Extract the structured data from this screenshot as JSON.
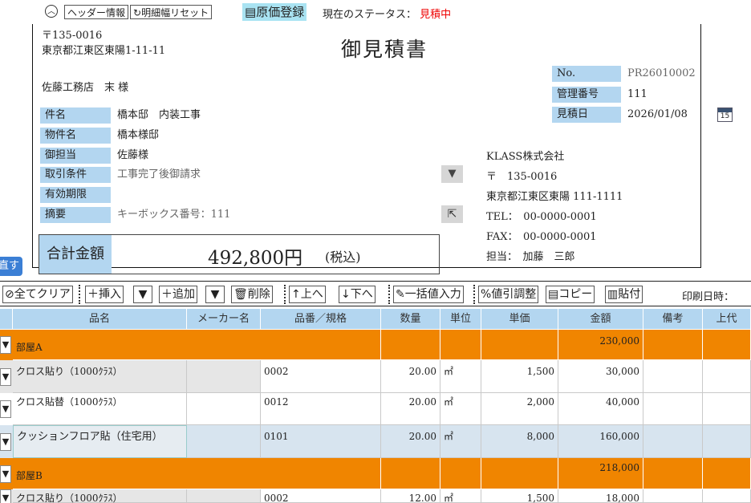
{
  "toolbar": {
    "header_info": "ヘッダー情報",
    "reset_width": "明細幅リセット",
    "cost_register": "原価登録",
    "status_label": "現在のステータス：",
    "status_value": "見積中"
  },
  "header": {
    "postal": "〒135-0016",
    "address": "東京都江東区東陽1-11-11",
    "title": "御見積書",
    "customer": "佐藤工務店　末 様",
    "fields": {
      "subject_label": "件名",
      "subject": "橋本邸　内装工事",
      "property_label": "物件名",
      "property": "橋本様邸",
      "contact_label": "御担当",
      "contact": "佐藤様",
      "terms_label": "取引条件",
      "terms": "工事完了後御請求",
      "validity_label": "有効期限",
      "validity": "",
      "note_label": "摘要",
      "note": "キーボックス番号：111"
    },
    "total_label": "合計金額",
    "total_value": "492,800円",
    "total_tax": "(税込)",
    "meta": {
      "no_label": "No.",
      "no": "PR26010002",
      "mgmt_label": "管理番号",
      "mgmt": "111",
      "date_label": "見積日",
      "date": "2026/01/08",
      "calendar_day": "15"
    },
    "company": {
      "name": "KLASS株式会社",
      "postal": "〒　135-0016",
      "address": "東京都江東区東陽 111-1111",
      "tel": "TEL：　00-0000-0001",
      "fax": "FAX：　00-0000-0001",
      "staff": "担当：　加藤　三郎"
    },
    "side_button": "直す"
  },
  "actions": {
    "clear_all": "全てクリア",
    "insert": "挿入",
    "add": "追加",
    "delete": "削除",
    "up": "上へ",
    "down": "下へ",
    "bulk_input": "一括値入力",
    "discount": "値引調整",
    "copy": "コピー",
    "paste": "貼付",
    "print_datetime": "印刷日時："
  },
  "table": {
    "headers": {
      "name": "品名",
      "maker": "メーカー名",
      "code": "品番／規格",
      "qty": "数量",
      "unit": "単位",
      "price": "単価",
      "amount": "金額",
      "remark": "備考",
      "upper": "上代"
    },
    "rows": [
      {
        "name": "部屋A",
        "maker": "",
        "code": "",
        "qty": "",
        "unit": "",
        "price": "",
        "amount": "230,000"
      },
      {
        "name": "クロス貼り（1000ｸﾗｽ）",
        "maker": "",
        "code": "0002",
        "qty": "20.00",
        "unit": "㎡",
        "price": "1,500",
        "amount": "30,000"
      },
      {
        "name": "クロス貼替（1000ｸﾗｽ）",
        "maker": "",
        "code": "0012",
        "qty": "20.00",
        "unit": "㎡",
        "price": "2,000",
        "amount": "40,000"
      },
      {
        "name": "クッションフロア貼（住宅用）",
        "maker": "",
        "code": "0101",
        "qty": "20.00",
        "unit": "㎡",
        "price": "8,000",
        "amount": "160,000"
      },
      {
        "name": "部屋B",
        "maker": "",
        "code": "",
        "qty": "",
        "unit": "",
        "price": "",
        "amount": "218,000"
      },
      {
        "name": "クロス貼り（1000ｸﾗｽ）",
        "maker": "",
        "code": "0002",
        "qty": "12.00",
        "unit": "㎡",
        "price": "1,500",
        "amount": "18,000"
      }
    ]
  }
}
